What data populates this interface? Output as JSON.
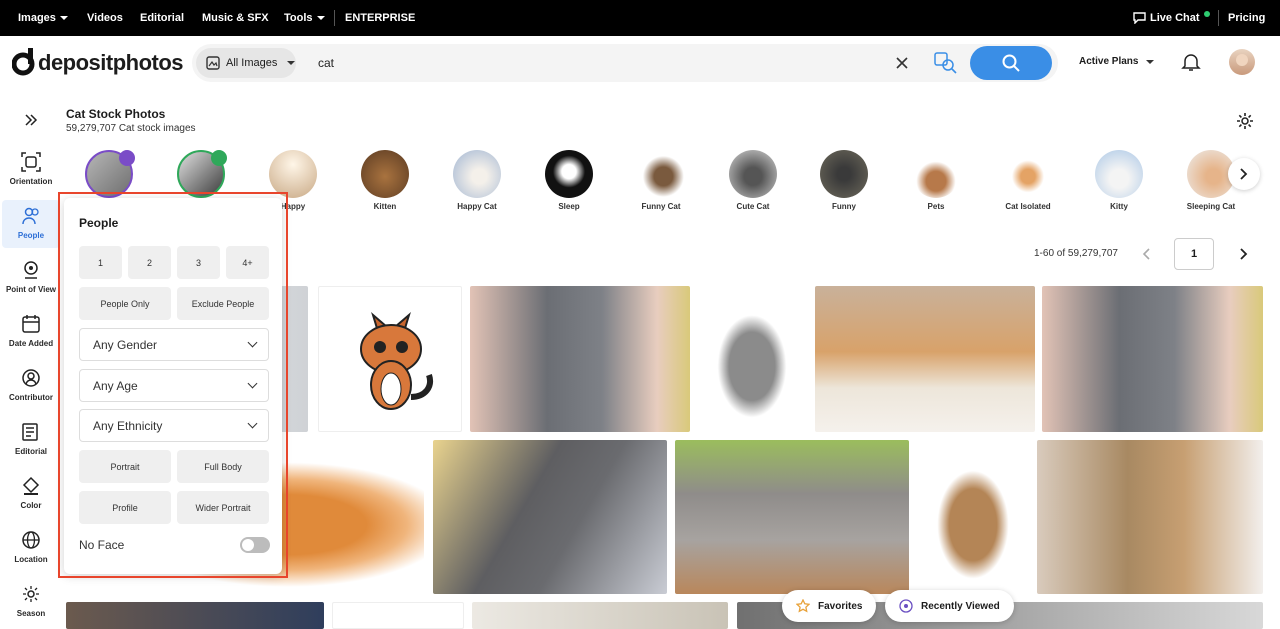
{
  "topnav": {
    "items": [
      {
        "label": "Images",
        "caret": true
      },
      {
        "label": "Videos",
        "caret": false
      },
      {
        "label": "Editorial",
        "caret": false
      },
      {
        "label": "Music & SFX",
        "caret": false
      },
      {
        "label": "Tools",
        "caret": true
      },
      {
        "label": "ENTERPRISE",
        "caret": false
      }
    ],
    "live_chat": "Live Chat",
    "pricing": "Pricing"
  },
  "header": {
    "logo": "depositphotos",
    "category": "All Images",
    "query": "cat",
    "active_plans": "Active Plans"
  },
  "rail": {
    "items": [
      "Orientation",
      "People",
      "Point of View",
      "Date Added",
      "Contributor",
      "Editorial",
      "Color",
      "Location",
      "Season"
    ]
  },
  "results": {
    "title": "Cat Stock Photos",
    "subtitle": "59,279,707 Cat stock images",
    "range": "1-60 of 59,279,707",
    "page": "1"
  },
  "chips": [
    "",
    "",
    "Happy",
    "Kitten",
    "Happy Cat",
    "Sleep",
    "Funny Cat",
    "Cute Cat",
    "Funny",
    "Pets",
    "Cat Isolated",
    "Kitty",
    "Sleeping Cat"
  ],
  "panel": {
    "title": "People",
    "counts": [
      "1",
      "2",
      "3",
      "4+"
    ],
    "only": "People Only",
    "exclude": "Exclude People",
    "gender": "Any Gender",
    "age": "Any Age",
    "ethnicity": "Any Ethnicity",
    "portrait": "Portrait",
    "full_body": "Full Body",
    "profile": "Profile",
    "wider_portrait": "Wider Portrait",
    "no_face": "No Face",
    "no_face_on": false
  },
  "bottom": {
    "favorites": "Favorites",
    "recently_viewed": "Recently Viewed"
  },
  "colors": {
    "accent": "#3a8ee6",
    "highlight": "#e8452c",
    "live_dot": "#2ecc71"
  }
}
